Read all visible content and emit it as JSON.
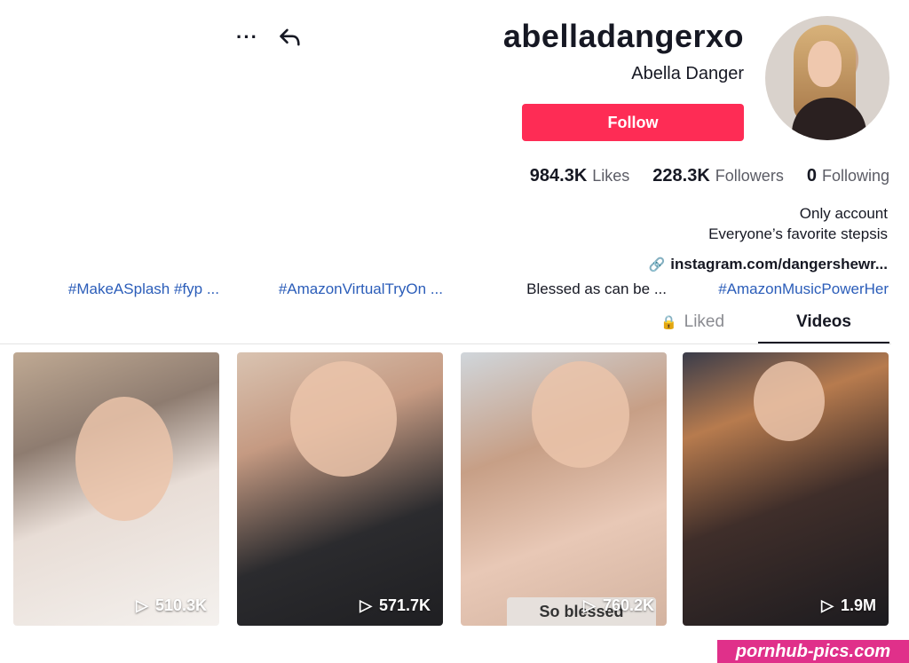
{
  "profile": {
    "username": "abelladangerxo",
    "display_name": "Abella Danger",
    "follow_label": "Follow",
    "more_label": "···"
  },
  "stats": {
    "following_count": "0",
    "following_label": "Following",
    "followers_count": "228.3K",
    "followers_label": "Followers",
    "likes_count": "984.3K",
    "likes_label": "Likes"
  },
  "bio": {
    "line1": "Only account",
    "line2": "Everyone’s favorite stepsis",
    "link": "instagram.com/dangershewr..."
  },
  "tabs": {
    "videos": "Videos",
    "liked": "Liked"
  },
  "videos": [
    {
      "views": "510.3K",
      "caption": "#MakeASplash #fyp ..."
    },
    {
      "views": "571.7K",
      "caption": "#AmazonVirtualTryOn ..."
    },
    {
      "views": "760.2K",
      "caption": "Blessed as can be ...",
      "overlay": "So blessed"
    },
    {
      "views": "1.9M",
      "caption": "#AmazonMusicPowerHer"
    }
  ],
  "watermark": "pornhub-pics.com",
  "colors": {
    "follow_button": "#fe2c55",
    "link_blue": "#2b5db9",
    "watermark_bg": "#e0308a"
  }
}
